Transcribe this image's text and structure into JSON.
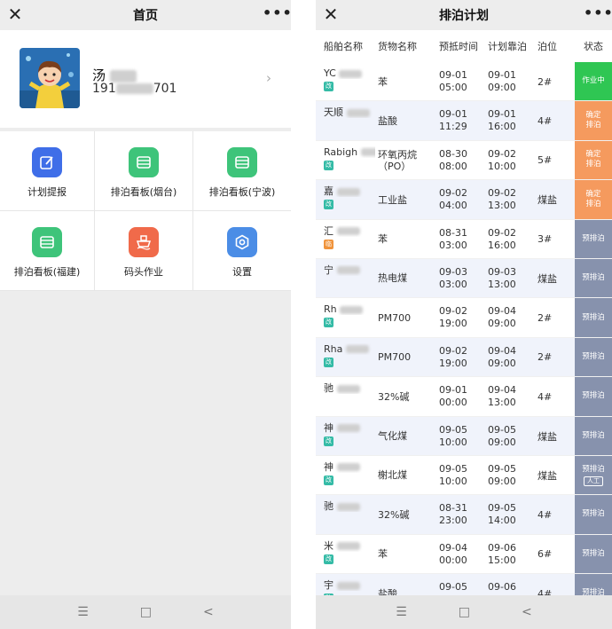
{
  "left": {
    "title": "首页",
    "profile": {
      "name": "汤",
      "phone_prefix": "191",
      "phone_suffix": "701"
    },
    "menu": [
      {
        "label": "计划提报",
        "icon": "edit-icon",
        "color": "#3f6ee8"
      },
      {
        "label": "排泊看板(烟台)",
        "icon": "board-icon",
        "color": "#3ec47a"
      },
      {
        "label": "排泊看板(宁波)",
        "icon": "board-icon",
        "color": "#3ec47a"
      },
      {
        "label": "排泊看板(福建)",
        "icon": "board-icon",
        "color": "#3ec47a"
      },
      {
        "label": "码头作业",
        "icon": "ship-icon",
        "color": "#f06a4a"
      },
      {
        "label": "设置",
        "icon": "gear-icon",
        "color": "#4b8de6"
      }
    ]
  },
  "right": {
    "title": "排泊计划",
    "headers": [
      "船舶名称",
      "货物名称",
      "预抵时间",
      "计划靠泊",
      "泊位",
      "状态"
    ],
    "rows": [
      {
        "ship": "YC",
        "badge": "改",
        "badge_color": "g",
        "cargo": "苯",
        "eta_d": "09-01",
        "eta_t": "05:00",
        "pln_d": "09-01",
        "pln_t": "09:00",
        "berth": "2#",
        "state": "作业中",
        "state_color": "green"
      },
      {
        "ship": "天顺",
        "badge": "",
        "badge_color": "",
        "cargo": "盐酸",
        "eta_d": "09-01",
        "eta_t": "11:29",
        "pln_d": "09-01",
        "pln_t": "16:00",
        "berth": "4#",
        "state": "确定\n排泊",
        "state_color": "orange"
      },
      {
        "ship": "Rabigh",
        "badge": "改",
        "badge_color": "g",
        "cargo": "环氧丙烷\n（PO）",
        "eta_d": "08-30",
        "eta_t": "08:00",
        "pln_d": "09-02",
        "pln_t": "10:00",
        "berth": "5#",
        "state": "确定\n排泊",
        "state_color": "orange"
      },
      {
        "ship": "嘉",
        "badge": "改",
        "badge_color": "g",
        "cargo": "工业盐",
        "eta_d": "09-02",
        "eta_t": "04:00",
        "pln_d": "09-02",
        "pln_t": "13:00",
        "berth": "煤盐",
        "state": "确定\n排泊",
        "state_color": "orange"
      },
      {
        "ship": "汇",
        "badge": "临",
        "badge_color": "o",
        "cargo": "苯",
        "eta_d": "08-31",
        "eta_t": "03:00",
        "pln_d": "09-02",
        "pln_t": "16:00",
        "berth": "3#",
        "state": "预排泊",
        "state_color": "gray"
      },
      {
        "ship": "宁",
        "badge": "",
        "badge_color": "",
        "cargo": "热电煤",
        "eta_d": "09-03",
        "eta_t": "03:00",
        "pln_d": "09-03",
        "pln_t": "13:00",
        "berth": "煤盐",
        "state": "预排泊",
        "state_color": "gray"
      },
      {
        "ship": "Rh",
        "badge": "改",
        "badge_color": "g",
        "cargo": "PM700",
        "eta_d": "09-02",
        "eta_t": "19:00",
        "pln_d": "09-04",
        "pln_t": "09:00",
        "berth": "2#",
        "state": "预排泊",
        "state_color": "gray"
      },
      {
        "ship": "Rha",
        "badge": "改",
        "badge_color": "g",
        "cargo": "PM700",
        "eta_d": "09-02",
        "eta_t": "19:00",
        "pln_d": "09-04",
        "pln_t": "09:00",
        "berth": "2#",
        "state": "预排泊",
        "state_color": "gray"
      },
      {
        "ship": "驰",
        "badge": "",
        "badge_color": "",
        "cargo": "32%碱",
        "eta_d": "09-01",
        "eta_t": "00:00",
        "pln_d": "09-04",
        "pln_t": "13:00",
        "berth": "4#",
        "state": "预排泊",
        "state_color": "gray"
      },
      {
        "ship": "神",
        "badge": "改",
        "badge_color": "g",
        "cargo": "气化煤",
        "eta_d": "09-05",
        "eta_t": "10:00",
        "pln_d": "09-05",
        "pln_t": "09:00",
        "berth": "煤盐",
        "state": "预排泊",
        "state_color": "gray"
      },
      {
        "ship": "神",
        "badge": "改",
        "badge_color": "g",
        "cargo": "榭北煤",
        "eta_d": "09-05",
        "eta_t": "10:00",
        "pln_d": "09-05",
        "pln_t": "09:00",
        "berth": "煤盐",
        "state": "预排泊",
        "state_color": "gray",
        "manual": "人工"
      },
      {
        "ship": "驰",
        "badge": "",
        "badge_color": "",
        "cargo": "32%碱",
        "eta_d": "08-31",
        "eta_t": "23:00",
        "pln_d": "09-05",
        "pln_t": "14:00",
        "berth": "4#",
        "state": "预排泊",
        "state_color": "gray"
      },
      {
        "ship": "米",
        "badge": "改",
        "badge_color": "g",
        "cargo": "苯",
        "eta_d": "09-04",
        "eta_t": "00:00",
        "pln_d": "09-06",
        "pln_t": "15:00",
        "berth": "6#",
        "state": "预排泊",
        "state_color": "gray"
      },
      {
        "ship": "宇",
        "badge": "改",
        "badge_color": "g",
        "cargo": "盐酸",
        "eta_d": "09-05",
        "eta_t": "",
        "pln_d": "09-06",
        "pln_t": "",
        "berth": "4#",
        "state": "预排泊",
        "state_color": "gray"
      }
    ]
  },
  "nav": {
    "menu": "☰",
    "home": "□",
    "back": "<"
  }
}
